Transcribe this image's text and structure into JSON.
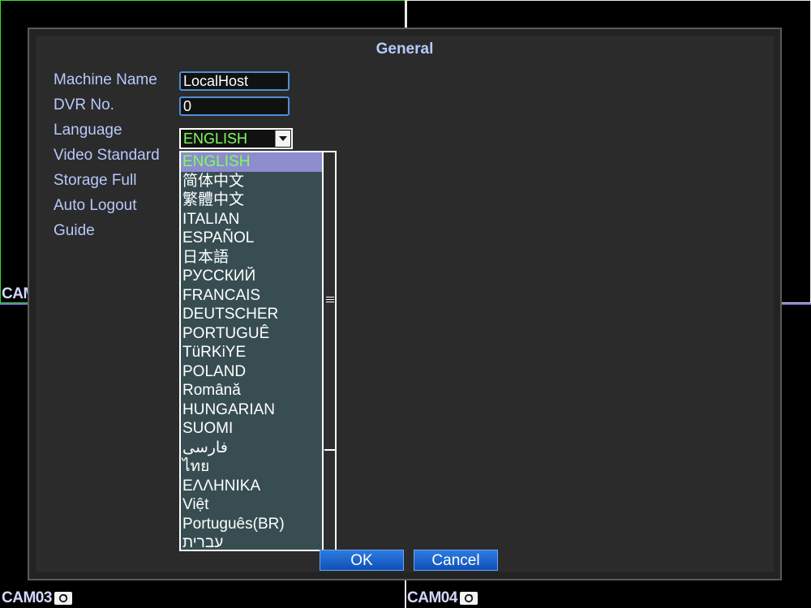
{
  "dialog": {
    "title": "General",
    "fields": {
      "machine_name_label": "Machine Name",
      "machine_name_value": "LocalHost",
      "dvr_no_label": "DVR No.",
      "dvr_no_value": "0",
      "language_label": "Language",
      "language_value": "ENGLISH",
      "video_standard_label": "Video Standard",
      "storage_full_label": "Storage Full",
      "auto_logout_label": "Auto Logout",
      "guide_label": "Guide"
    },
    "language_options": [
      "ENGLISH",
      "简体中文",
      "繁體中文",
      "ITALIAN",
      "ESPAÑOL",
      "日本語",
      "РУССКИЙ",
      "FRANCAIS",
      "DEUTSCHER",
      "PORTUGUÊ",
      "TüRKiYE",
      "POLAND",
      "Română",
      "HUNGARIAN",
      "SUOMI",
      "فارسی",
      "ไทย",
      "ΕΛΛΗΝΙΚΑ",
      "Việt",
      "Português(BR)",
      "עברית"
    ],
    "selected_option": "ENGLISH",
    "buttons": {
      "ok": "OK",
      "cancel": "Cancel"
    }
  },
  "cameras": {
    "cam_left_partial": "CAM",
    "cam3": "CAM03",
    "cam4": "CAM04"
  },
  "colors": {
    "label": "#b8c8ff",
    "selected_text": "#7dff5a",
    "selected_bg": "#8c8ccf",
    "button": "#1f64cc"
  }
}
